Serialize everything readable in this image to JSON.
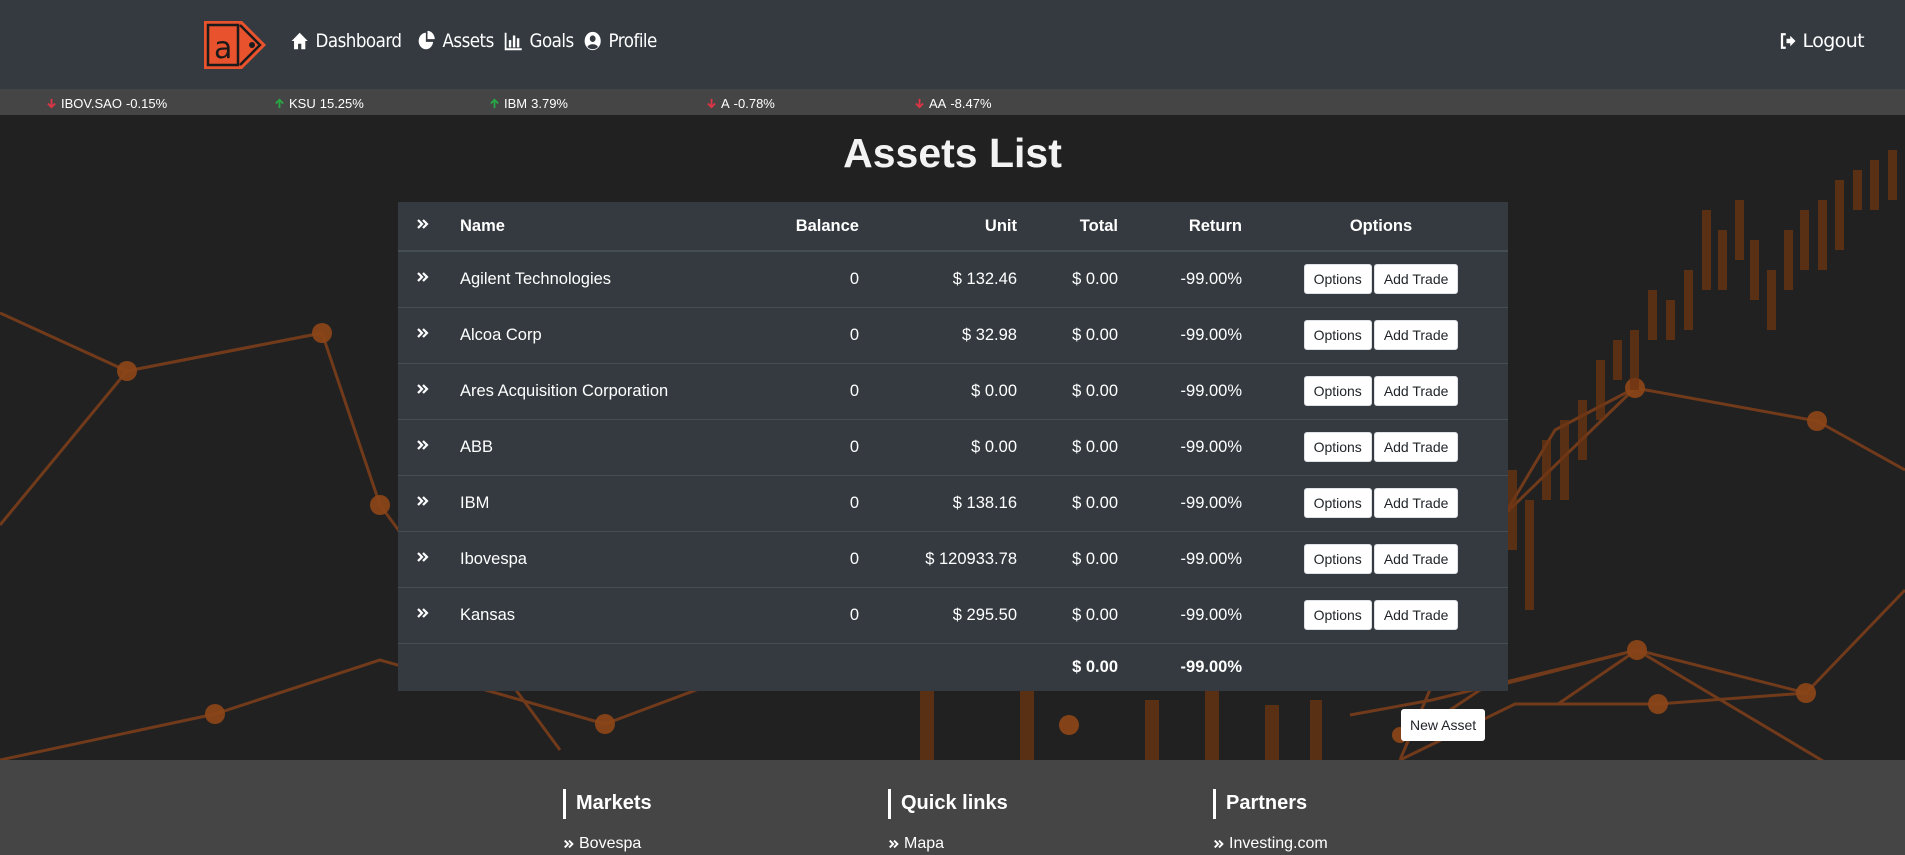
{
  "nav": {
    "logo_text": "a",
    "links": [
      {
        "label": "Dashboard",
        "icon": "home-icon"
      },
      {
        "label": "Assets",
        "icon": "pie-chart-icon"
      },
      {
        "label": "Goals",
        "icon": "bar-chart-icon"
      },
      {
        "label": "Profile",
        "icon": "user-circle-icon"
      }
    ],
    "logout": "Logout"
  },
  "ticker": [
    {
      "symbol": "IBOV.SAO",
      "change": "-0.15%",
      "direction": "down"
    },
    {
      "symbol": "KSU",
      "change": "15.25%",
      "direction": "up"
    },
    {
      "symbol": "IBM",
      "change": "3.79%",
      "direction": "up"
    },
    {
      "symbol": "A",
      "change": "-0.78%",
      "direction": "down"
    },
    {
      "symbol": "AA",
      "change": "-8.47%",
      "direction": "down"
    }
  ],
  "colors": {
    "up": "#28a745",
    "down": "#dc3545",
    "accent": "#e8532e"
  },
  "page_title": "Assets List",
  "table": {
    "headers": {
      "name": "Name",
      "balance": "Balance",
      "unit": "Unit",
      "total": "Total",
      "return": "Return",
      "options": "Options"
    },
    "rows": [
      {
        "name": "Agilent Technologies",
        "balance": "0",
        "unit": "$ 132.46",
        "total": "$ 0.00",
        "return": "-99.00%"
      },
      {
        "name": "Alcoa Corp",
        "balance": "0",
        "unit": "$ 32.98",
        "total": "$ 0.00",
        "return": "-99.00%"
      },
      {
        "name": "Ares Acquisition Corporation",
        "balance": "0",
        "unit": "$ 0.00",
        "total": "$ 0.00",
        "return": "-99.00%"
      },
      {
        "name": "ABB",
        "balance": "0",
        "unit": "$ 0.00",
        "total": "$ 0.00",
        "return": "-99.00%"
      },
      {
        "name": "IBM",
        "balance": "0",
        "unit": "$ 138.16",
        "total": "$ 0.00",
        "return": "-99.00%"
      },
      {
        "name": "Ibovespa",
        "balance": "0",
        "unit": "$ 120933.78",
        "total": "$ 0.00",
        "return": "-99.00%"
      },
      {
        "name": "Kansas",
        "balance": "0",
        "unit": "$ 295.50",
        "total": "$ 0.00",
        "return": "-99.00%"
      }
    ],
    "row_buttons": {
      "options": "Options",
      "add_trade": "Add Trade"
    },
    "footer": {
      "total": "$ 0.00",
      "return": "-99.00%"
    }
  },
  "new_asset": "New Asset",
  "footer": {
    "columns": [
      {
        "title": "Markets",
        "first_link": "Bovespa"
      },
      {
        "title": "Quick links",
        "first_link": "Mapa"
      },
      {
        "title": "Partners",
        "first_link": "Investing.com"
      }
    ]
  }
}
